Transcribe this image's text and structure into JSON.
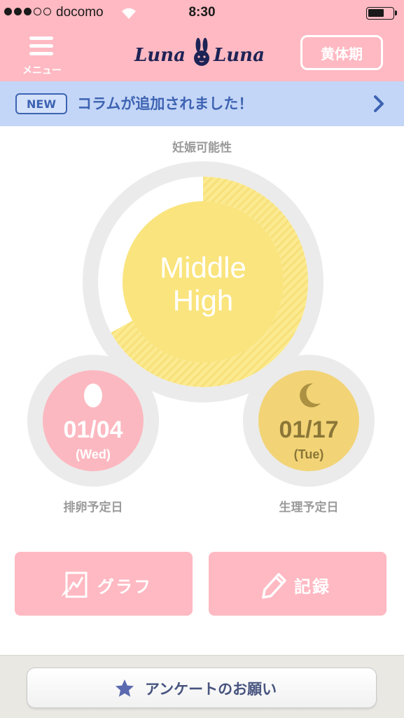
{
  "status_bar": {
    "carrier": "docomo",
    "time": "8:30"
  },
  "nav": {
    "menu_label": "メニュー",
    "logo_left": "Luna",
    "logo_right": "Luna",
    "phase_button": "黄体期"
  },
  "banner": {
    "badge": "NEW",
    "text": "コラムが追加されました！"
  },
  "fertility": {
    "caption": "妊娠可能性",
    "level_line1": "Middle",
    "level_line2": "High",
    "progress_fraction": 0.67
  },
  "ovulation": {
    "date": "01/04",
    "day": "(Wed)",
    "caption": "排卵予定日"
  },
  "period": {
    "date": "01/17",
    "day": "(Tue)",
    "caption": "生理予定日"
  },
  "actions": {
    "graph_label": "グラフ",
    "record_label": "記録"
  },
  "survey": {
    "label": "アンケートのお願い"
  },
  "colors": {
    "header_pink": "#ffb9c2",
    "banner_blue": "#c4d6f7",
    "gauge_yellow": "#fae47d",
    "ovulation_pink": "#fcb8c0",
    "period_gold": "#f2d477",
    "accent_blue": "#3d63b2"
  }
}
